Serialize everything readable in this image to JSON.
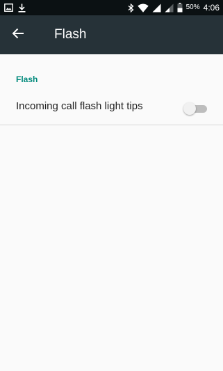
{
  "status_bar": {
    "time": "4:06",
    "battery_percent": "50%",
    "icons": [
      "image-notification-icon",
      "download-icon",
      "bluetooth-icon",
      "wifi-icon",
      "signal-icon",
      "signal-weak-icon",
      "battery-icon"
    ]
  },
  "toolbar": {
    "title": "Flash",
    "back_icon": "arrow-back-icon"
  },
  "settings": {
    "section_title": "Flash",
    "items": [
      {
        "label": "Incoming call flash light tips",
        "toggle_state": "off"
      }
    ]
  },
  "colors": {
    "status_bar_bg": "#0b1113",
    "toolbar_bg": "#263238",
    "accent": "#00897b",
    "background": "#fafafa"
  }
}
